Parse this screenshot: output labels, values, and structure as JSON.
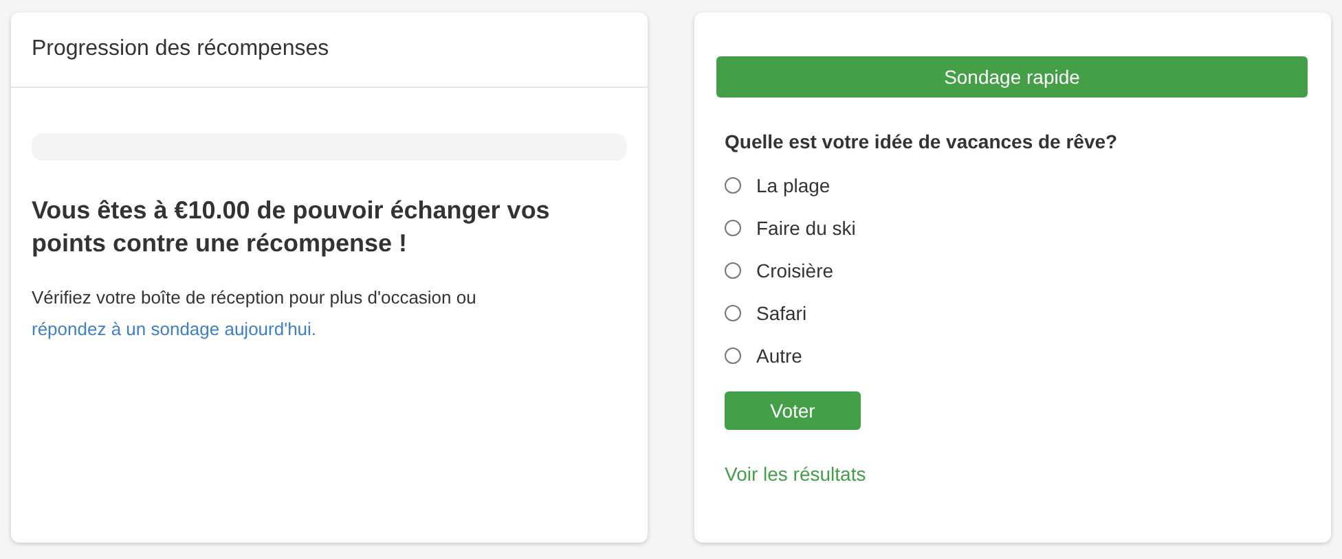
{
  "rewards_card": {
    "title": "Progression des récompenses",
    "progress": {
      "level": 0
    },
    "headline": "Vous êtes à €10.00 de pouvoir échanger vos points contre une récompense !",
    "message": "Vérifiez votre boîte de réception pour plus d'occasion ou",
    "link": "répondez à un sondage aujourd'hui."
  },
  "poll_card": {
    "title": "Sondage rapide",
    "question": "Quelle est votre idée de vacances de rêve?",
    "options": [
      {
        "label": "La plage",
        "selected": false
      },
      {
        "label": "Faire du ski",
        "selected": false
      },
      {
        "label": "Croisière",
        "selected": false
      },
      {
        "label": "Safari",
        "selected": false
      },
      {
        "label": "Autre",
        "selected": false
      }
    ],
    "vote_button": "Voter",
    "results_link": "Voir les résultats"
  }
}
